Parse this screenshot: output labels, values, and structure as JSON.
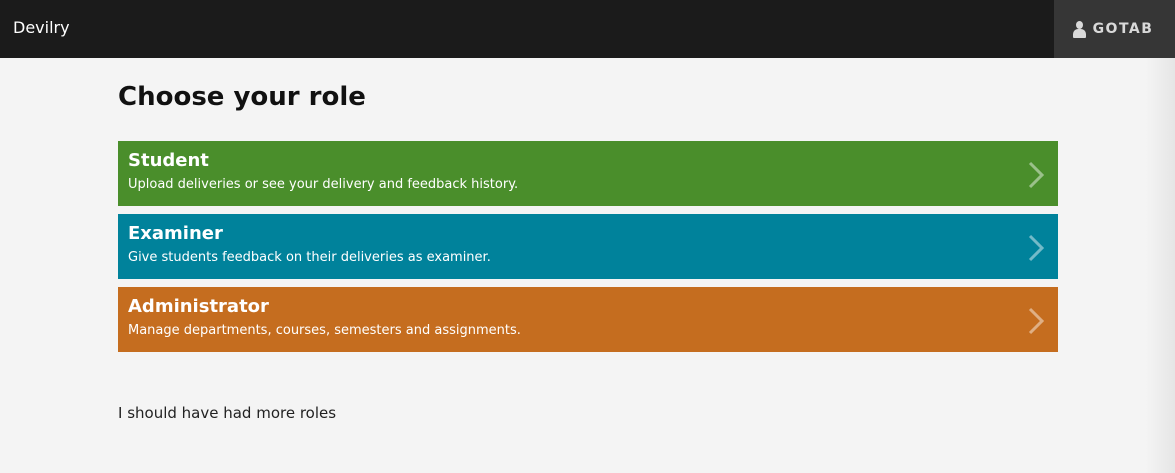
{
  "header": {
    "brand": "Devilry",
    "user": {
      "icon": "user-icon",
      "name": "GOTAB"
    }
  },
  "main": {
    "title": "Choose your role",
    "roles": [
      {
        "title": "Student",
        "description": "Upload deliveries or see your delivery and feedback history.",
        "color": "#4a8e2b",
        "icon": "chevron-right-icon"
      },
      {
        "title": "Examiner",
        "description": "Give students feedback on their deliveries as examiner.",
        "color": "#00829b",
        "icon": "chevron-right-icon"
      },
      {
        "title": "Administrator",
        "description": "Manage departments, courses, semesters and assignments.",
        "color": "#c56d1f",
        "icon": "chevron-right-icon"
      }
    ],
    "footer_note": "I should have had more roles"
  },
  "colors": {
    "topbar": "#1b1b1b",
    "user_button": "#363636",
    "page_background": "#f4f4f4"
  }
}
